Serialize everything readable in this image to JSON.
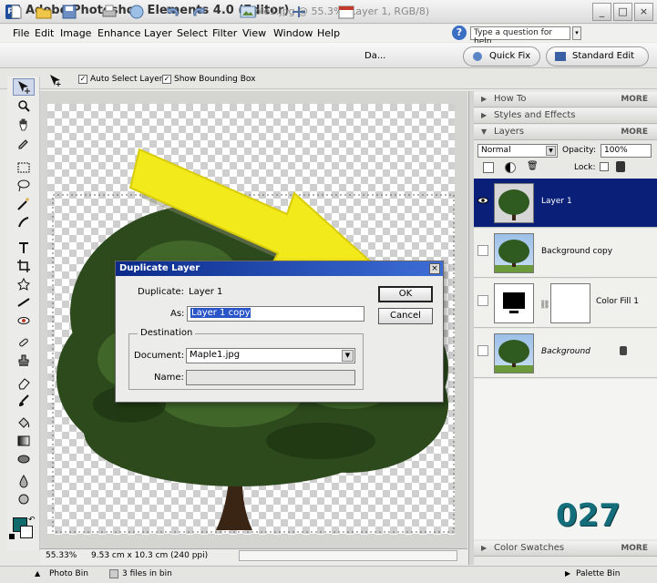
{
  "titlebar": {
    "app_title": "Adobe Photoshop Elements 4.0 (Editor)",
    "document_title": "Maple1.jpg @ 55.3% (Layer 1, RGB/8)",
    "minimize": "_",
    "maximize": "□",
    "close": "×"
  },
  "menu": [
    "File",
    "Edit",
    "Image",
    "Enhance",
    "Layer",
    "Select",
    "Filter",
    "View",
    "Window",
    "Help"
  ],
  "help": {
    "placeholder": "Type a question for help"
  },
  "toolbar": {
    "date_view_label": "Da...",
    "quick_fix": "Quick Fix",
    "standard_edit": "Standard Edit"
  },
  "options": {
    "auto_select": "Auto Select Layer",
    "show_bounding_box": "Show Bounding Box"
  },
  "status": {
    "zoom": "55.33%",
    "doc_size": "9.53 cm x 10.3 cm (240 ppi)"
  },
  "bottom": {
    "photo_bin": "Photo Bin",
    "files_in_bin": "3 files in bin",
    "palette_bin": "Palette Bin"
  },
  "palettes": {
    "how_to": "How To",
    "styles_effects": "Styles and Effects",
    "layers": "Layers",
    "more": "MORE",
    "blend_mode": "Normal",
    "opacity_label": "Opacity:",
    "opacity_value": "100%",
    "lock_label": "Lock:",
    "color_swatches": "Color Swatches"
  },
  "layers": [
    {
      "name": "Layer 1"
    },
    {
      "name": "Background copy"
    },
    {
      "name": "Color Fill 1"
    },
    {
      "name": "Background"
    }
  ],
  "dialog": {
    "title": "Duplicate Layer",
    "duplicate_label": "Duplicate:",
    "duplicate_value": "Layer 1",
    "as_label": "As:",
    "as_value": "Layer 1 copy",
    "destination_label": "Destination",
    "document_label": "Document:",
    "document_value": "Maple1.jpg",
    "name_label": "Name:",
    "ok": "OK",
    "cancel": "Cancel"
  },
  "watermark": "027",
  "colors": {
    "selected_layer": "#0a1f78",
    "dialog_title": "#0b2a8a",
    "arrow": "#f2ea1a",
    "foreground_swatch": "#0f6b6b"
  }
}
